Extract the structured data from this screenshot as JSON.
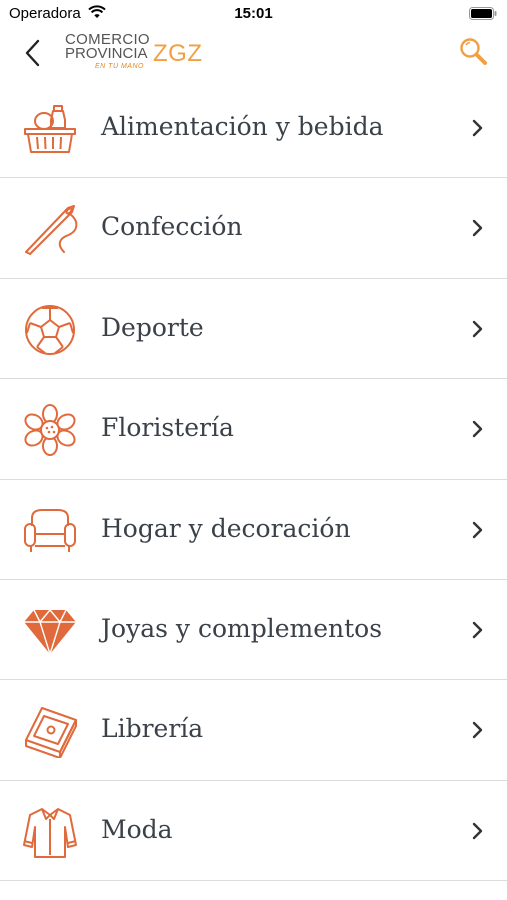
{
  "status_bar": {
    "carrier": "Operadora",
    "time": "15:01"
  },
  "header": {
    "logo": {
      "line1": "COMERCIO",
      "line2": "PROVINCIA",
      "accent": "ZGZ",
      "tagline": "EN TU MANO"
    },
    "back_icon": "chevron-left-icon",
    "search_icon": "search-icon"
  },
  "colors": {
    "accent": "#e06a3c",
    "logo_orange": "#f0a042",
    "divider": "#dcdcdc",
    "text": "#3b4148"
  },
  "categories": [
    {
      "label": "Alimentación y bebida",
      "icon": "food-basket-icon"
    },
    {
      "label": "Confección",
      "icon": "needle-thread-icon"
    },
    {
      "label": "Deporte",
      "icon": "soccer-ball-icon"
    },
    {
      "label": "Floristería",
      "icon": "flower-icon"
    },
    {
      "label": "Hogar y decoración",
      "icon": "armchair-icon"
    },
    {
      "label": "Joyas y complementos",
      "icon": "diamond-icon"
    },
    {
      "label": "Librería",
      "icon": "book-icon"
    },
    {
      "label": "Moda",
      "icon": "shirt-icon"
    }
  ]
}
